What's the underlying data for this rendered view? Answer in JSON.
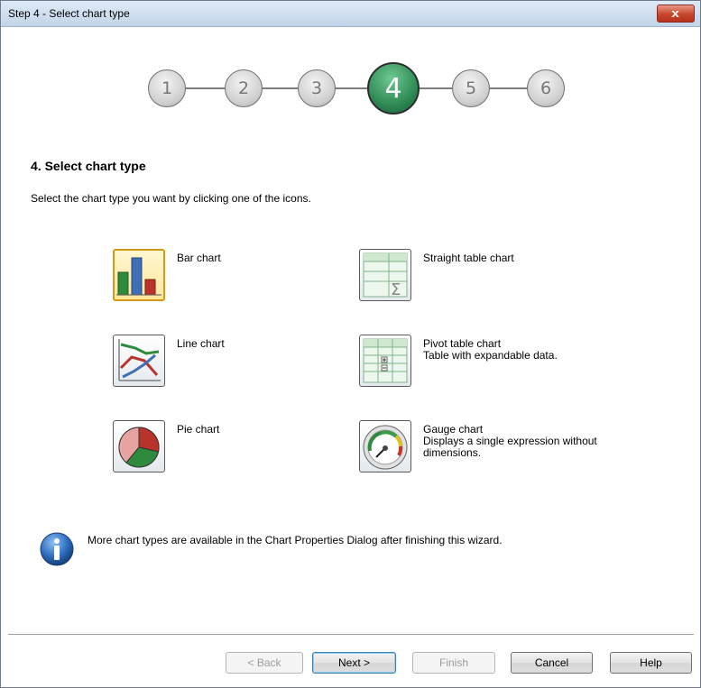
{
  "window": {
    "title": "Step 4 - Select chart type",
    "close_label": "x"
  },
  "steps": {
    "items": [
      "1",
      "2",
      "3",
      "4",
      "5",
      "6"
    ],
    "active": "4"
  },
  "content": {
    "heading": "4. Select chart type",
    "intro": "Select the chart type you want by clicking one of the icons."
  },
  "chart_types": {
    "bar": {
      "label": "Bar chart",
      "icon": "bar-chart-icon",
      "selected": true
    },
    "line": {
      "label": "Line chart",
      "icon": "line-chart-icon"
    },
    "pie": {
      "label": "Pie chart",
      "icon": "pie-chart-icon"
    },
    "straight": {
      "label": "Straight table chart",
      "icon": "straight-table-icon"
    },
    "pivot": {
      "label": "Pivot table chart",
      "desc": "Table with expandable data.",
      "icon": "pivot-table-icon"
    },
    "gauge": {
      "label": "Gauge chart",
      "desc": "Displays a single expression without dimensions.",
      "icon": "gauge-chart-icon"
    }
  },
  "info": {
    "icon": "info-icon",
    "text": "More chart types are available in the Chart Properties Dialog after finishing this wizard."
  },
  "buttons": {
    "back": "< Back",
    "next": "Next >",
    "finish": "Finish",
    "cancel": "Cancel",
    "help": "Help"
  },
  "colors": {
    "active_step": "#2f8a54",
    "selected_border": "#d39a1a",
    "close": "#c7452c"
  }
}
